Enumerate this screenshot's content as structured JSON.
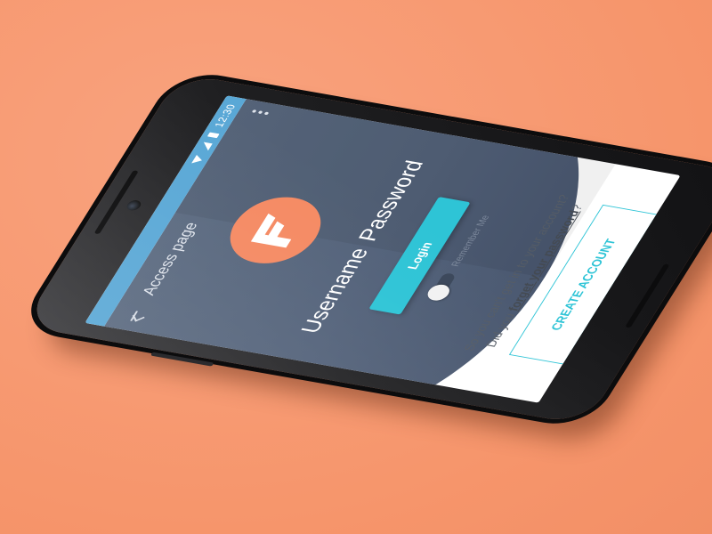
{
  "status_bar": {
    "time": "12:30",
    "icons": [
      "wifi-icon",
      "signal-icon",
      "battery-icon"
    ]
  },
  "app_bar": {
    "title": "Access page",
    "back_icon": "back-arrow-icon",
    "menu_icon": "overflow-menu-icon"
  },
  "logo": {
    "icon": "logo-f-icon"
  },
  "form": {
    "username_placeholder": "Username",
    "password_placeholder": "Password",
    "login_label": "Login",
    "remember_label": "Remember Me",
    "remember_checked": false
  },
  "help": {
    "line1": "So you can't get in to your account?",
    "line2_prefix": "Did you ",
    "line2_link": "forget your password",
    "line2_suffix": "?"
  },
  "create_account": {
    "label": "CREATE ACCOUNT"
  },
  "colors": {
    "background": "#f79a73",
    "header": "#53627a",
    "status_bar": "#5aa8d6",
    "accent": "#2ec4d6",
    "logo": "#f58a63"
  }
}
